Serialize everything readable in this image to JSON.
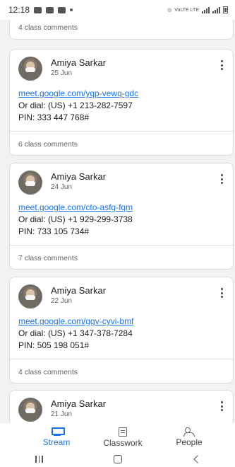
{
  "status_bar": {
    "time": "12:18",
    "network_text": "VoLTE LTE"
  },
  "top_partial": {
    "comments": "4 class comments"
  },
  "posts": [
    {
      "author": "Amiya Sarkar",
      "date": "25 Jun",
      "link": "meet.google.com/yqp-vewq-gdc",
      "dial": "Or dial: (US) +1 213-282-7597",
      "pin": "PIN: 333 447 768#",
      "comments": "6 class comments"
    },
    {
      "author": "Amiya Sarkar",
      "date": "24 Jun",
      "link": "meet.google.com/cto-asfg-fqm",
      "dial": "Or dial: (US) +1 929-299-3738",
      "pin": "PIN: 733 105 734#",
      "comments": "7 class comments"
    },
    {
      "author": "Amiya Sarkar",
      "date": "22 Jun",
      "link": "meet.google.com/ggv-cyvi-bmf",
      "dial": "Or dial: (US) +1 347-378-7284",
      "pin": "PIN: 505 198 051#",
      "comments": "4 class comments"
    },
    {
      "author": "Amiya Sarkar",
      "date": "21 Jun"
    }
  ],
  "bottom_nav": {
    "items": [
      {
        "label": "Stream",
        "icon": "stream-icon",
        "active": true
      },
      {
        "label": "Classwork",
        "icon": "classwork-icon",
        "active": false
      },
      {
        "label": "People",
        "icon": "people-icon",
        "active": false
      }
    ]
  },
  "colors": {
    "accent": "#1a73e8",
    "link": "#1a73e8",
    "muted_text": "#5f6368",
    "background": "#f2f2f2"
  }
}
